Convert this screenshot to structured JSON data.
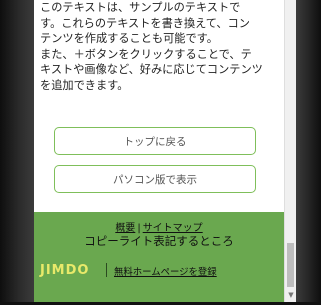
{
  "body": {
    "lines": [
      "このテキストは、サンプルのテキストで",
      "す。これらのテキストを書き換えて、コン",
      "テンツを作成することも可能です。",
      "また、＋ボタンをクリックすることで、テ",
      "キストや画像など、好みに応じてコンテンツ",
      "を追加できます。"
    ]
  },
  "buttons": {
    "back_to_top": "トップに戻る",
    "pc_view": "パソコン版で表示"
  },
  "footer": {
    "about_link": "概要",
    "separator": "|",
    "sitemap_link": "サイトマップ",
    "copyright": "コピーライト表記するところ",
    "logo_text": "JIMDO",
    "register_link": "無料ホームページを登録",
    "background_color": "#6aa84f"
  },
  "scrollbar": {
    "down_arrow_icon": "▼"
  }
}
